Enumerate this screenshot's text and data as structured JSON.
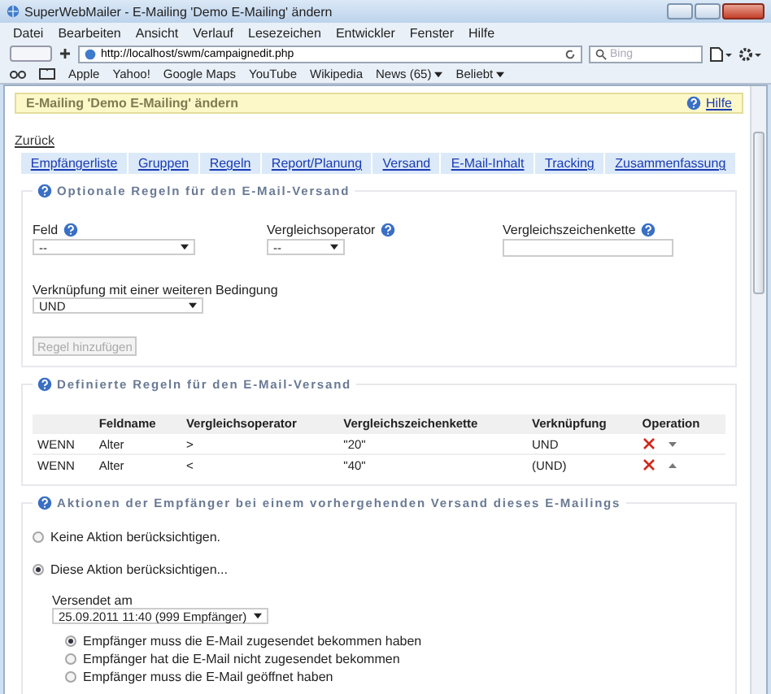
{
  "window": {
    "title": "SuperWebMailer - E-Mailing 'Demo E-Mailing' ändern"
  },
  "menu": [
    "Datei",
    "Bearbeiten",
    "Ansicht",
    "Verlauf",
    "Lesezeichen",
    "Entwickler",
    "Fenster",
    "Hilfe"
  ],
  "address_bar": {
    "url": "http://localhost/swm/campaignedit.php"
  },
  "search": {
    "placeholder": "Bing"
  },
  "bookmarks": [
    {
      "label": "Apple",
      "dropdown": false
    },
    {
      "label": "Yahoo!",
      "dropdown": false
    },
    {
      "label": "Google Maps",
      "dropdown": false
    },
    {
      "label": "YouTube",
      "dropdown": false
    },
    {
      "label": "Wikipedia",
      "dropdown": false
    },
    {
      "label": "News (65)",
      "dropdown": true
    },
    {
      "label": "Beliebt",
      "dropdown": true
    }
  ],
  "page": {
    "header": "E-Mailing 'Demo E-Mailing' ändern",
    "help_link": "Hilfe",
    "back_link": "Zurück"
  },
  "tabs": [
    {
      "label": "Empfängerliste",
      "selected": false
    },
    {
      "label": "Gruppen",
      "selected": false
    },
    {
      "label": "Regeln",
      "selected": false
    },
    {
      "label": "Report/Planung",
      "selected": false
    },
    {
      "label": "Versand",
      "selected": false
    },
    {
      "label": "E-Mail-Inhalt",
      "selected": false
    },
    {
      "label": "Tracking",
      "selected": false
    },
    {
      "label": "Zusammenfassung",
      "selected": false
    }
  ],
  "optional_rules": {
    "legend": "Optionale Regeln für den E-Mail-Versand",
    "fields": [
      {
        "label": "Feld",
        "kind": "select",
        "value": "--"
      },
      {
        "label": "Vergleichsoperator",
        "kind": "select",
        "value": "--"
      },
      {
        "label": "Vergleichszeichenkette",
        "kind": "text"
      }
    ],
    "link_label": "Verknüpfung mit einer weiteren Bedingung",
    "link_value": "UND",
    "add_button": {
      "label": "Regel hinzufügen",
      "disabled": true
    }
  },
  "defined_rules": {
    "legend": "Definierte Regeln für den E-Mail-Versand",
    "columns": [
      "",
      "Feldname",
      "Vergleichsoperator",
      "Vergleichszeichenkette",
      "Verknüpfung",
      "Operation"
    ],
    "rows": [
      {
        "cells": [
          "WENN",
          "Alter",
          ">",
          "\"20\"",
          "UND"
        ],
        "move_down": true,
        "move_up": false
      },
      {
        "cells": [
          "WENN",
          "Alter",
          "<",
          "\"40\"",
          "(UND)"
        ],
        "move_down": false,
        "move_up": true
      }
    ]
  },
  "actions": {
    "legend": "Aktionen der Empfänger bei einem vorhergehenden Versand dieses E-Mailings",
    "options": [
      {
        "label": "Keine Aktion berücksichtigen.",
        "selected": false
      },
      {
        "label": "Diese Aktion berücksichtigen...",
        "selected": true
      }
    ],
    "sent_label": "Versendet am",
    "sent_value": "25.09.2011 11:40 (999 Empfänger)",
    "conditions": [
      {
        "label": "Empfänger muss die E-Mail zugesendet bekommen haben",
        "selected": true
      },
      {
        "label": "Empfänger hat die E-Mail nicht zugesendet bekommen",
        "selected": false
      },
      {
        "label": "Empfänger muss die E-Mail geöffnet haben",
        "selected": false
      }
    ]
  }
}
